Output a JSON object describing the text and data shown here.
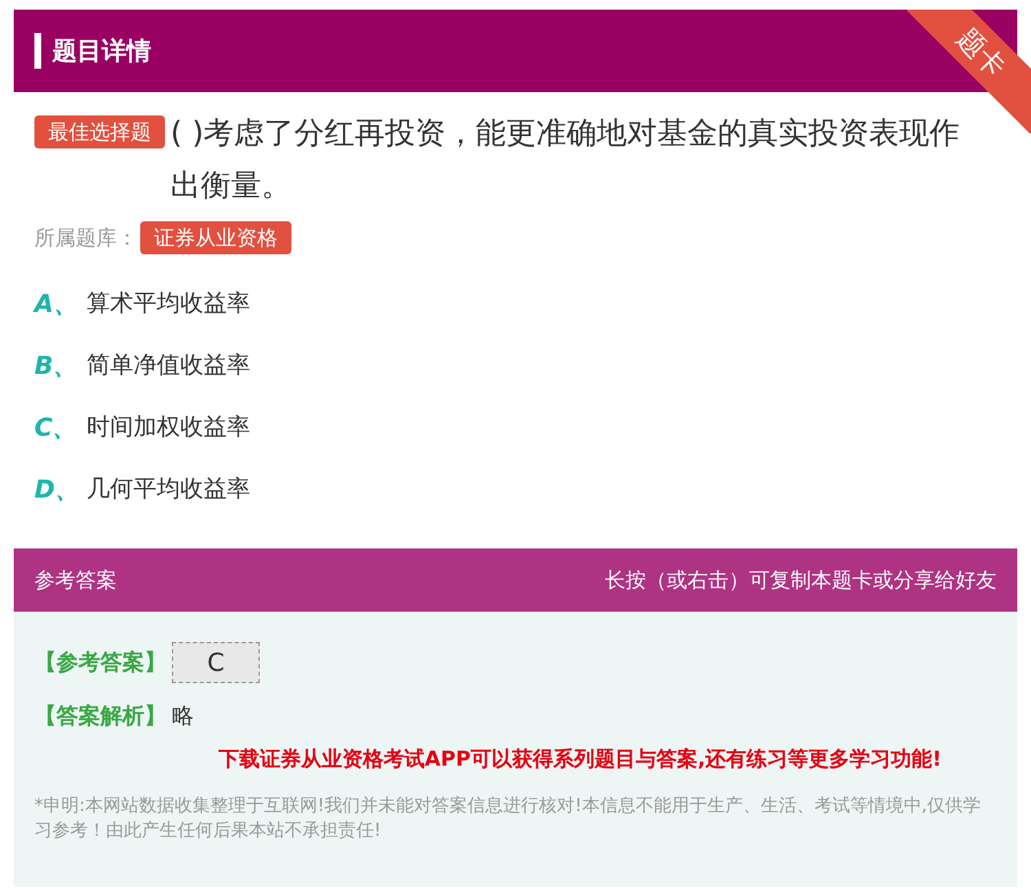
{
  "header": {
    "title": "题目详情",
    "ribbon": "题卡"
  },
  "question": {
    "type_tag": "最佳选择题",
    "text": "( )考虑了分红再投资，能更准确地对基金的真实投资表现作出衡量。",
    "bank_label": "所属题库：",
    "bank_tag": "证券从业资格"
  },
  "options": [
    {
      "letter": "A、",
      "text": "算术平均收益率"
    },
    {
      "letter": "B、",
      "text": "简单净值收益率"
    },
    {
      "letter": "C、",
      "text": "时间加权收益率"
    },
    {
      "letter": "D、",
      "text": "几何平均收益率"
    }
  ],
  "answer_bar": {
    "title": "参考答案",
    "hint": "长按（或右击）可复制本题卡或分享给好友"
  },
  "answer": {
    "answer_label": "【参考答案】",
    "answer_value": "C",
    "analysis_label": "【答案解析】",
    "analysis_value": "略",
    "promo": "下载证券从业资格考试APP可以获得系列题目与答案,还有练习等更多学习功能!",
    "disclaimer": "*申明:本网站数据收集整理于互联网!我们并未能对答案信息进行核对!本信息不能用于生产、生活、考试等情境中,仅供学习参考！由此产生任何后果本站不承担责任!"
  }
}
